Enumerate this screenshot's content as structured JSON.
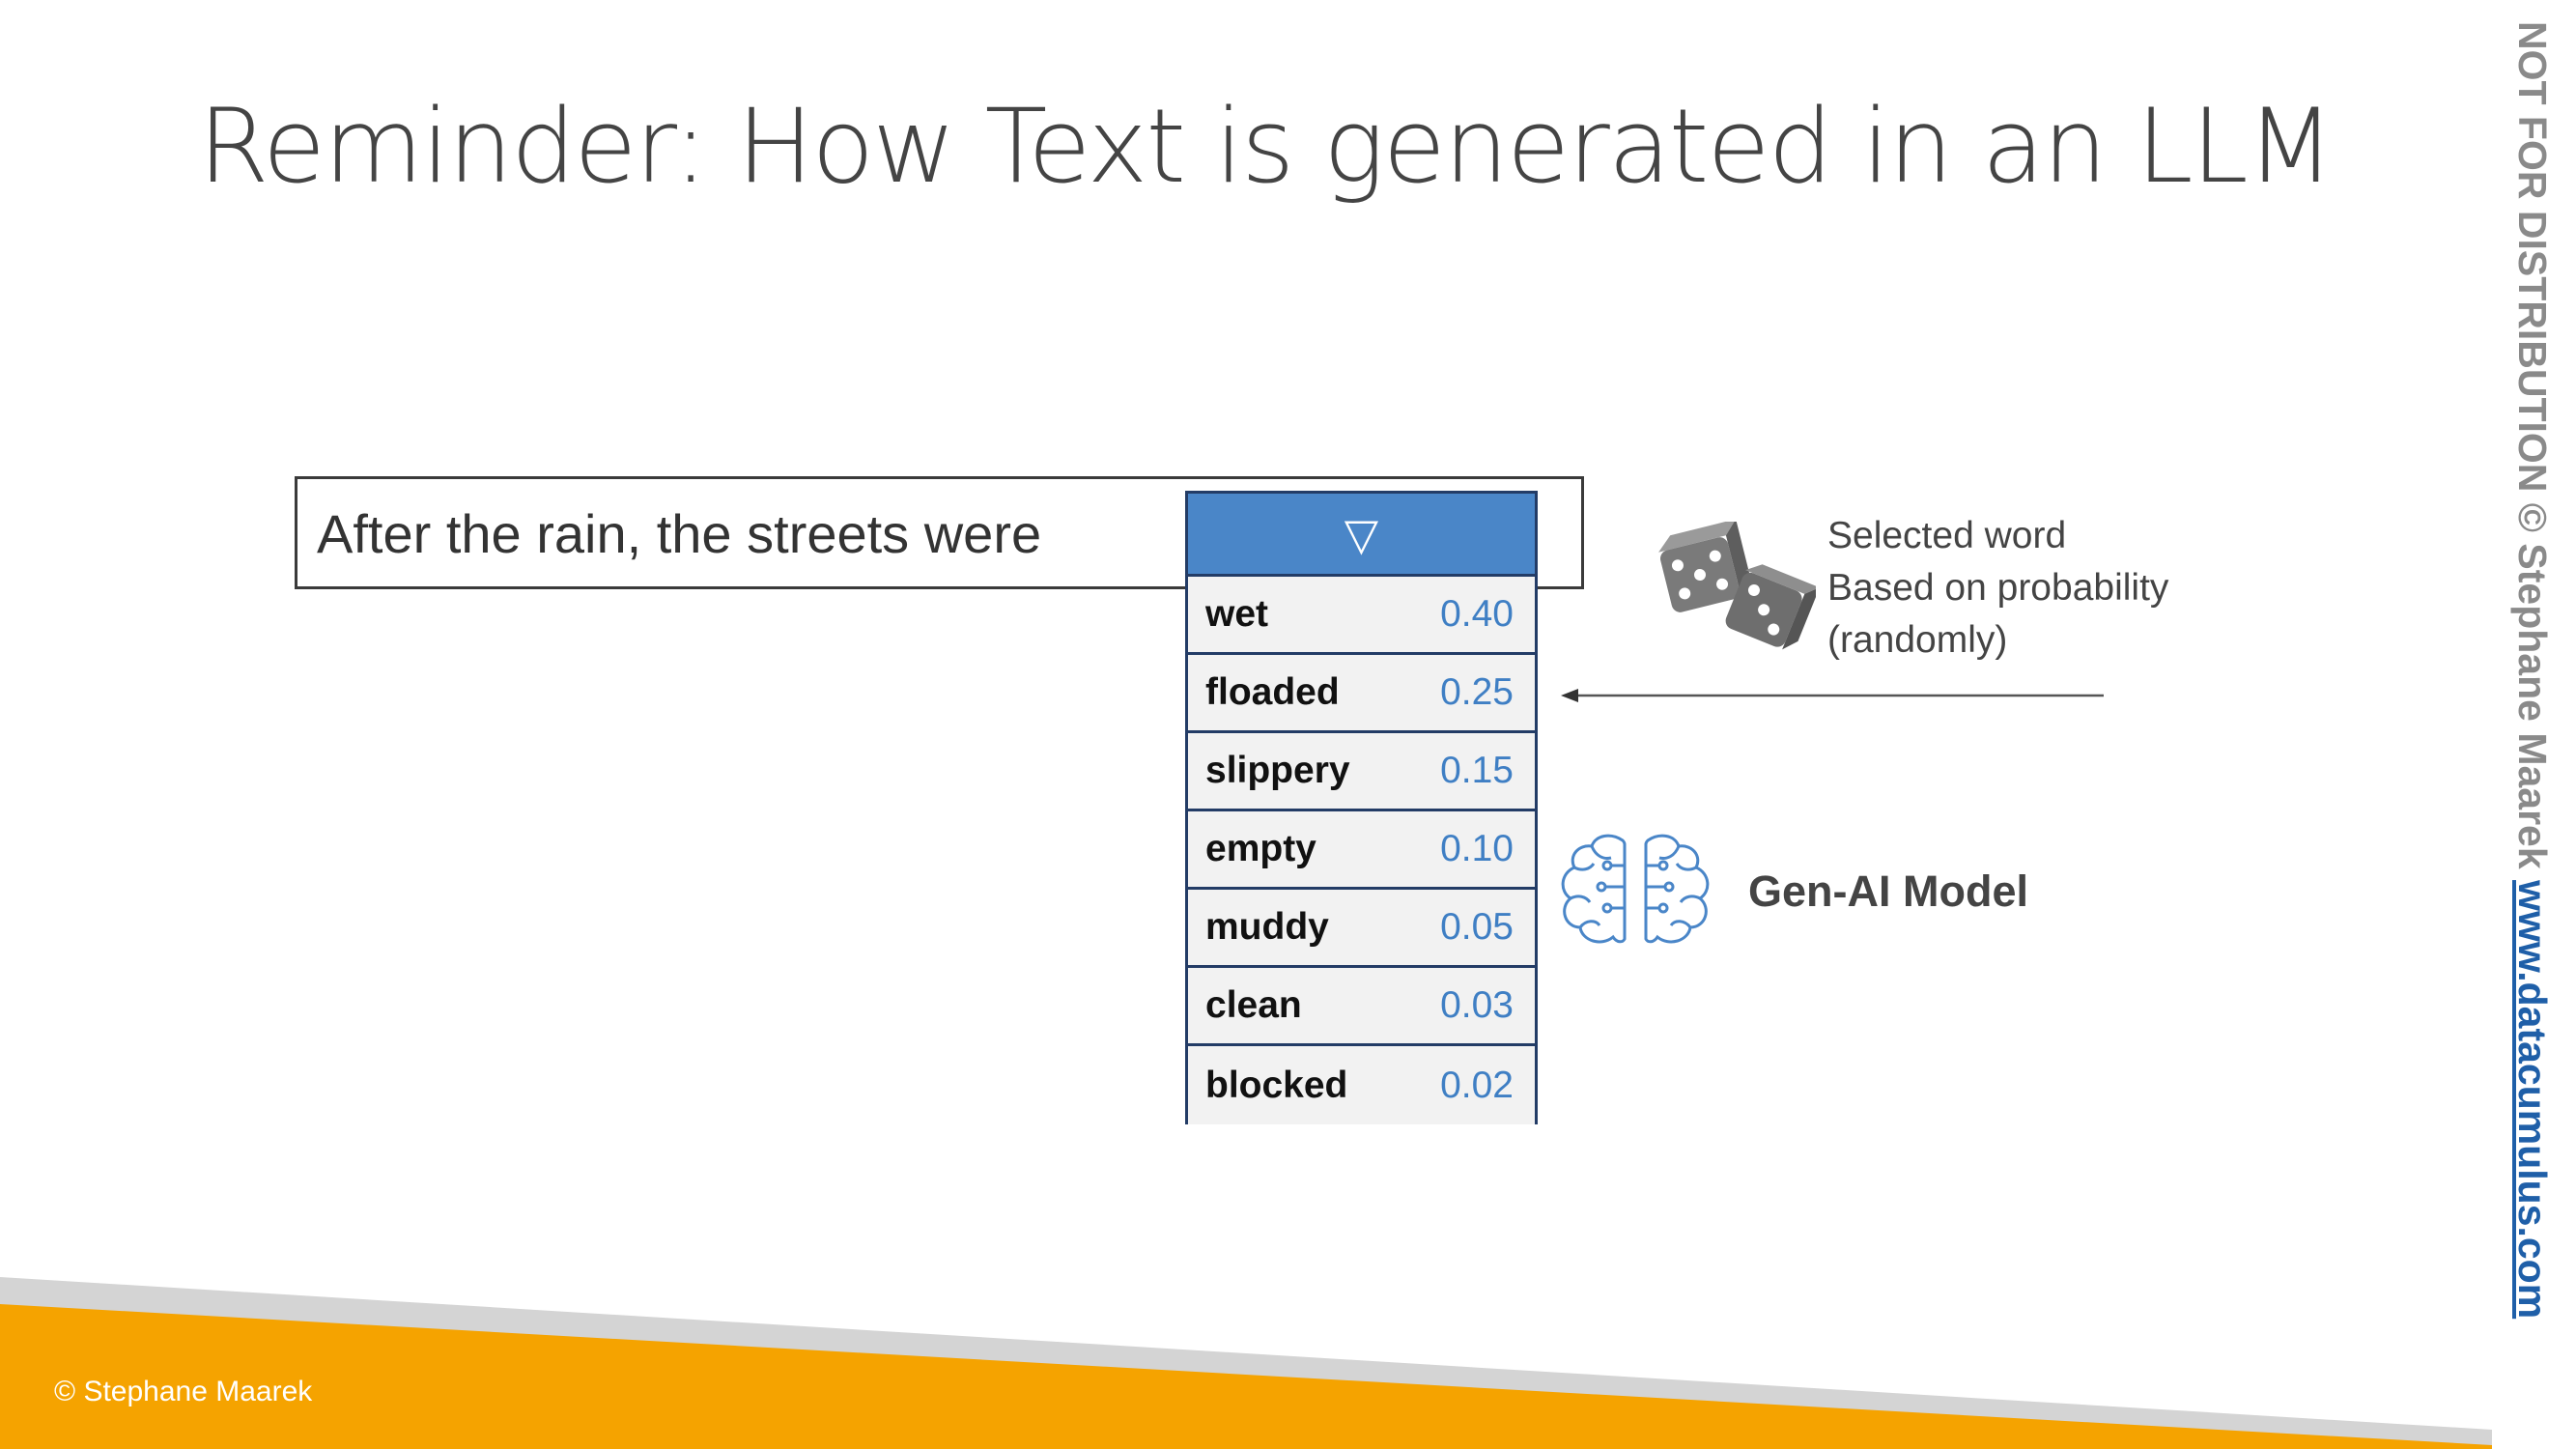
{
  "slide": {
    "title": "Reminder: How Text is generated in an LLM",
    "prompt_sentence": "After the rain, the streets were",
    "dropdown": {
      "toggle_glyph": "▽",
      "options": [
        {
          "word": "wet",
          "probability": "0.40"
        },
        {
          "word": "floaded",
          "probability": "0.25"
        },
        {
          "word": "slippery",
          "probability": "0.15"
        },
        {
          "word": "empty",
          "probability": "0.10"
        },
        {
          "word": "muddy",
          "probability": "0.05"
        },
        {
          "word": "clean",
          "probability": "0.03"
        },
        {
          "word": "blocked",
          "probability": "0.02"
        }
      ],
      "selected_index": 1
    },
    "dice_caption": [
      "Selected word",
      "Based on probability",
      "(randomly)"
    ],
    "model_label": "Gen-AI Model",
    "footer_copyright": "© Stephane Maarek",
    "watermark": {
      "text": "NOT FOR DISTRIBUTION © Stephane Maarek",
      "site": "www.datacumulus.com"
    }
  },
  "icons": {
    "dice": "dice-icon",
    "brain": "brain-circuit-icon",
    "arrow": "arrow-left-icon"
  },
  "colors": {
    "accent_blue": "#4a86c8",
    "probability_blue": "#3f7fc4",
    "footer_orange": "#f5a300",
    "footer_gray": "#d4d4d4",
    "text_dark": "#444444"
  }
}
